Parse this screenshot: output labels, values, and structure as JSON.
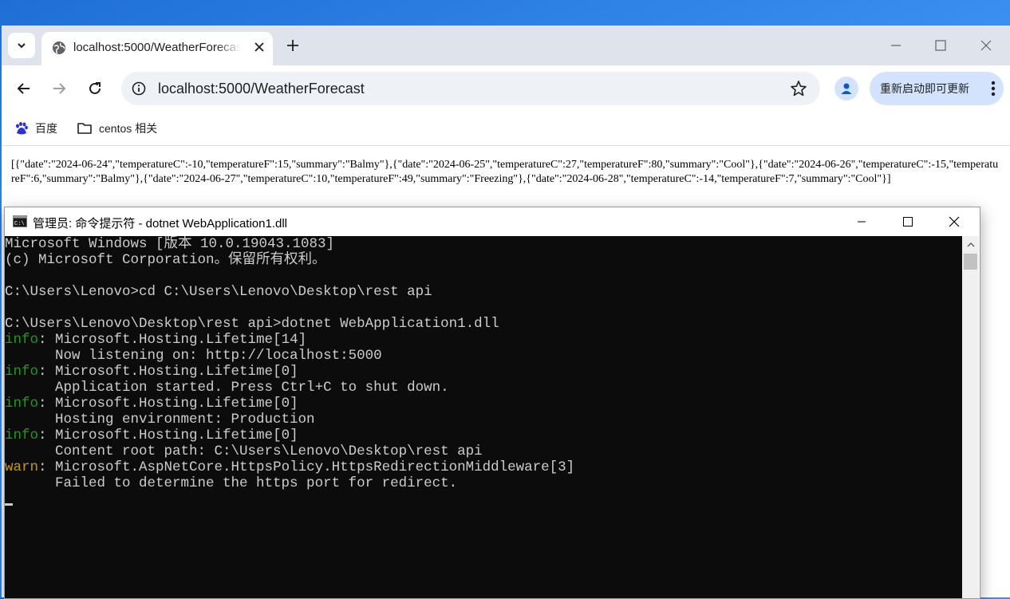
{
  "browser": {
    "tab": {
      "title": "localhost:5000/WeatherForecast"
    },
    "address": {
      "url": "localhost:5000/WeatherForecast"
    },
    "update_button_label": "重新启动即可更新",
    "bookmarks": [
      {
        "label": "百度",
        "icon": "baidu-icon"
      },
      {
        "label": "centos 相关",
        "icon": "folder-icon"
      }
    ],
    "page_json": "[{\"date\":\"2024-06-24\",\"temperatureC\":-10,\"temperatureF\":15,\"summary\":\"Balmy\"},{\"date\":\"2024-06-25\",\"temperatureC\":27,\"temperatureF\":80,\"summary\":\"Cool\"},{\"date\":\"2024-06-26\",\"temperatureC\":-15,\"temperatureF\":6,\"summary\":\"Balmy\"},{\"date\":\"2024-06-27\",\"temperatureC\":10,\"temperatureF\":49,\"summary\":\"Freezing\"},{\"date\":\"2024-06-28\",\"temperatureC\":-14,\"temperatureF\":7,\"summary\":\"Cool\"}]"
  },
  "cmd": {
    "title": "管理员: 命令提示符 - dotnet  WebApplication1.dll",
    "lines": [
      "Microsoft Windows [版本 10.0.19043.1083]",
      "(c) Microsoft Corporation。保留所有权利。",
      "",
      "C:\\Users\\Lenovo>cd C:\\Users\\Lenovo\\Desktop\\rest api",
      "",
      "C:\\Users\\Lenovo\\Desktop\\rest api>dotnet WebApplication1.dll"
    ],
    "logs": [
      {
        "level": "info",
        "source": ": Microsoft.Hosting.Lifetime[14]",
        "message": "      Now listening on: http://localhost:5000"
      },
      {
        "level": "info",
        "source": ": Microsoft.Hosting.Lifetime[0]",
        "message": "      Application started. Press Ctrl+C to shut down."
      },
      {
        "level": "info",
        "source": ": Microsoft.Hosting.Lifetime[0]",
        "message": "      Hosting environment: Production"
      },
      {
        "level": "info",
        "source": ": Microsoft.Hosting.Lifetime[0]",
        "message": "      Content root path: C:\\Users\\Lenovo\\Desktop\\rest api"
      },
      {
        "level": "warn",
        "source": ": Microsoft.AspNetCore.HttpsPolicy.HttpsRedirectionMiddleware[3]",
        "message": "      Failed to determine the https port for redirect."
      }
    ]
  },
  "colors": {
    "info": "#13a10e",
    "warn": "#c19c00",
    "console_bg": "#0c0c0c",
    "console_fg": "#cccccc",
    "desktop": "#2a7de0"
  }
}
